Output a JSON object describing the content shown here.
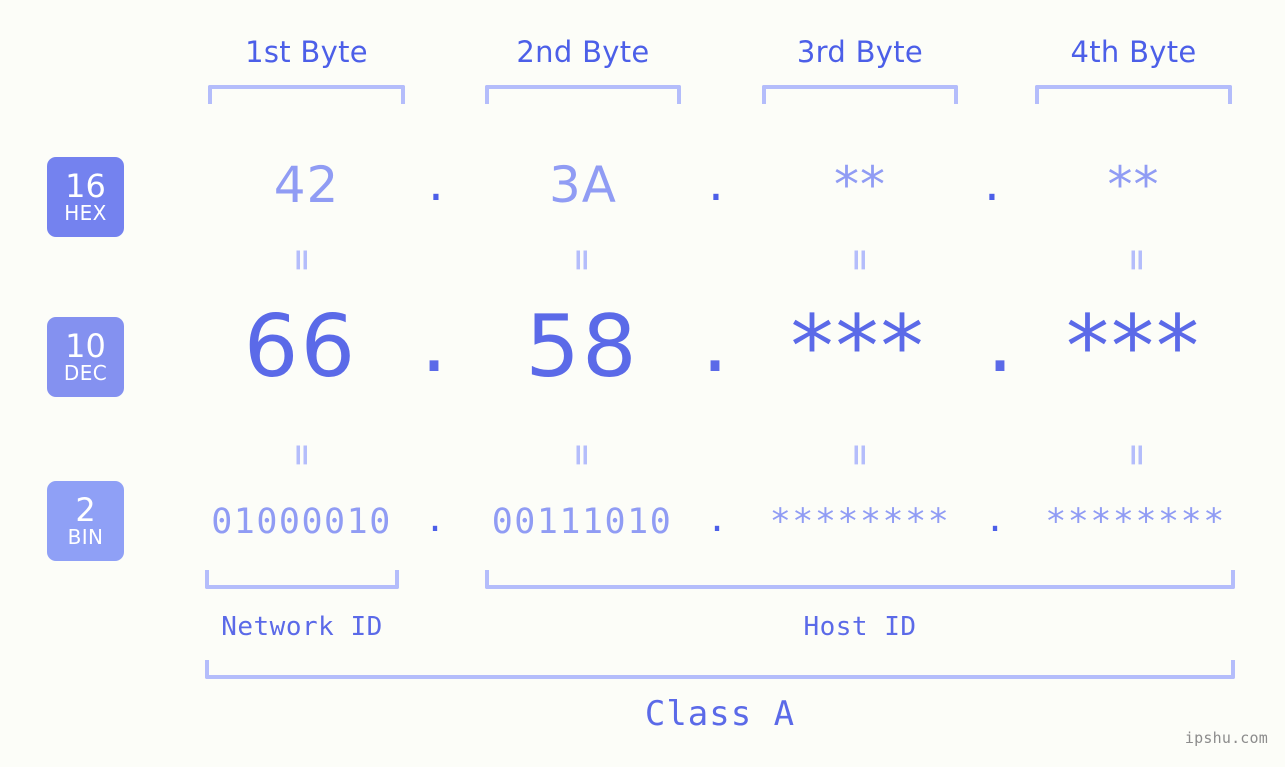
{
  "background_color": "#fcfdf8",
  "accent_color": "#5b6ae8",
  "light_accent_color": "#b4bdfb",
  "muted_value_color": "#909cf4",
  "columns": [
    {
      "header": "1st Byte"
    },
    {
      "header": "2nd Byte"
    },
    {
      "header": "3rd Byte"
    },
    {
      "header": "4th Byte"
    }
  ],
  "rows": [
    {
      "badge_number": "16",
      "badge_label": "HEX",
      "badge_color": "#7482ef",
      "values": [
        "42",
        "3A",
        "**",
        "**"
      ],
      "separator": "."
    },
    {
      "badge_number": "10",
      "badge_label": "DEC",
      "badge_color": "#8491f0",
      "values": [
        "66",
        "58",
        "***",
        "***"
      ],
      "separator": "."
    },
    {
      "badge_number": "2",
      "badge_label": "BIN",
      "badge_color": "#8fa0f6",
      "values": [
        "01000010",
        "00111010",
        "********",
        "********"
      ],
      "separator": "."
    }
  ],
  "equals_glyph": "=",
  "footer": {
    "network_id_label": "Network ID",
    "host_id_label": "Host ID",
    "class_label": "Class A"
  },
  "watermark": "ipshu.com"
}
